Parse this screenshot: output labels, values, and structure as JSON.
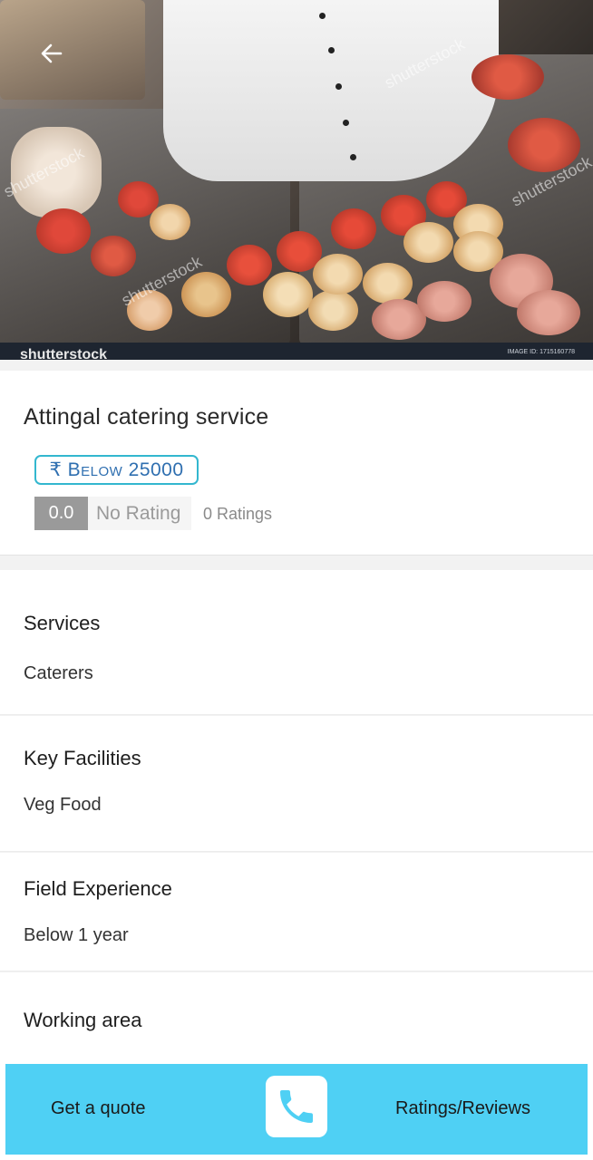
{
  "hero": {
    "watermark": "shutterstock",
    "image_id": "IMAGE ID: 1715160778",
    "back_icon": "arrow-left-icon"
  },
  "vendor": {
    "name": "Attingal catering service",
    "price_badge": "₹ Below 25000",
    "rating_value": "0.0",
    "rating_label": "No Rating",
    "rating_count": "0 Ratings"
  },
  "sections": [
    {
      "title": "Services",
      "value": "Caterers"
    },
    {
      "title": "Key Facilities",
      "value": "Veg Food"
    },
    {
      "title": "Field Experience",
      "value": "Below 1 year"
    },
    {
      "title": "Working area",
      "value": ""
    }
  ],
  "bottom_bar": {
    "quote_label": "Get a quote",
    "reviews_label": "Ratings/Reviews",
    "call_icon": "phone-icon",
    "color": "#4fd0f4"
  },
  "colors": {
    "badge_border": "#33b7cf",
    "badge_text": "#2f6fb0",
    "rating_bg": "#9a9a9a"
  }
}
